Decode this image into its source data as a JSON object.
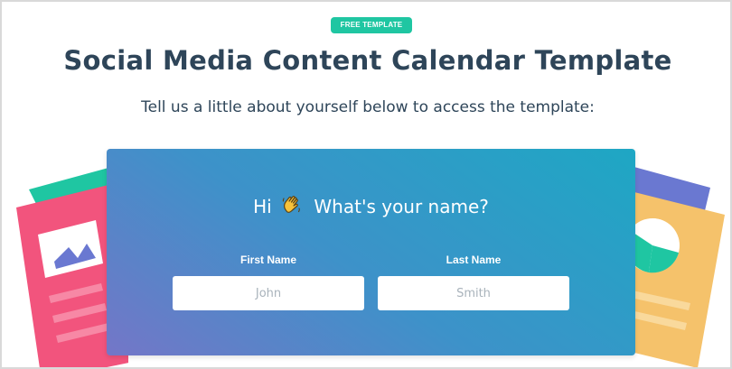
{
  "badge": {
    "label": "FREE TEMPLATE"
  },
  "header": {
    "title": "Social Media Content Calendar Template",
    "subtitle": "Tell us a little about yourself below to access the template:"
  },
  "form": {
    "greeting_prefix": "Hi",
    "greeting_suffix": "What's your name?",
    "first_name": {
      "label": "First Name",
      "placeholder": "John"
    },
    "last_name": {
      "label": "Last Name",
      "placeholder": "Smith"
    }
  },
  "colors": {
    "badge": "#1fc6a2",
    "title": "#2e4559",
    "gradient_start": "#7476c8",
    "gradient_end": "#1ea7c4"
  },
  "icons": [
    "waving-hand-icon",
    "image-icon",
    "pie-chart-icon"
  ]
}
